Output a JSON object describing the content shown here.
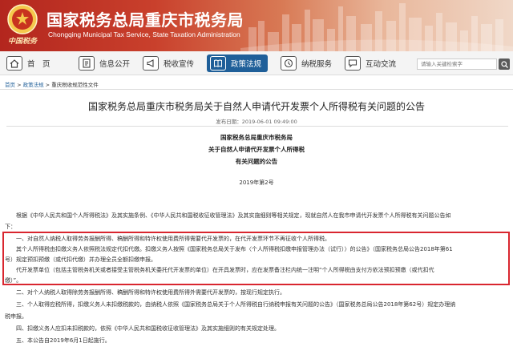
{
  "header": {
    "title": "国家税务总局重庆市税务局",
    "subtitle": "Chongqing Municipal Tax Service, State Taxation Administration",
    "emblem_text": "中国税务",
    "brand_color": "#b3261e"
  },
  "nav": {
    "items": [
      {
        "label": "首　页",
        "icon": "home-icon"
      },
      {
        "label": "信息公开",
        "icon": "document-icon"
      },
      {
        "label": "税收宣传",
        "icon": "megaphone-icon"
      },
      {
        "label": "政策法规",
        "icon": "book-icon",
        "active": true
      },
      {
        "label": "纳税服务",
        "icon": "service-icon"
      },
      {
        "label": "互动交流",
        "icon": "chat-icon"
      }
    ],
    "search_placeholder": "请输入关键检索字",
    "active_color": "#1f5f99"
  },
  "breadcrumb": {
    "home": "首页",
    "separator": " > ",
    "section": "政策法规",
    "current": "重庆税收规范性文件"
  },
  "article": {
    "title": "国家税务总局重庆市税务局关于自然人申请代开发票个人所得税有关问题的公告",
    "publish_date": "发布日期：2019-06-01 09:49:00",
    "center_lines": [
      "国家税务总局重庆市税务局",
      "关于自然人申请代开发票个人所得税",
      "有关问题的公告"
    ],
    "doc_number": "2019年第2号",
    "paragraphs": [
      "　　根据《中华人民共和国个人所得税法》及其实施条例、《中华人民共和国税收征收管理法》及其实施细则等相关规定，现就自然人在我市申请代开发票个人所得税有关问题公告如",
      "下：",
      "　　一、对自然人纳税人取得劳务报酬所得、稿酬所得和特许权使用费所得需要代开发票的，在代开发票环节不再征收个人所得税。",
      "　　其个人所得税由扣缴义务人依照税法规定代扣代缴。扣缴义务人按照《国家税务总局关于发布〈个人所得税扣缴申报管理办法（试行）〉的公告》（国家税务总局公告2018年第61",
      "号）规定预扣预缴（或代扣代缴）并办理全员全额扣缴申报。",
      "　　代开发票单位（包括主管税务机关或者接受主管税务机关委托代开发票的单位）在开具发票时，应在发票备注栏内统一注明“个人所得税由支付方依法预扣预缴（或代扣代",
      "缴）”。",
      "　　二、对个人纳税人取得除劳务报酬所得、稿酬所得和特许权使用费所得外需要代开发票的，按现行规定执行。",
      "　　三、个人取得应税所得，扣缴义务人未扣缴税款的，由纳税人依照《国家税务总局关于个人所得税自行纳税申报有关问题的公告》（国家税务总局公告2018年第62号）规定办理纳",
      "税申报。",
      "　　四、扣缴义务人应扣未扣税款的，依照《中华人民共和国税收征收管理法》及其实施细则的有关规定处理。",
      "　　五、本公告自2019年6月1日起施行。"
    ],
    "highlight_color": "#d9262f"
  }
}
